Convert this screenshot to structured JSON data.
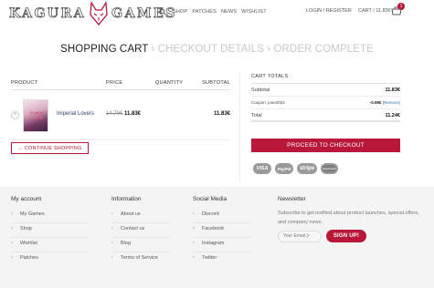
{
  "header": {
    "logo_left": "KAGURA",
    "logo_right": "GAMES",
    "nav": [
      "SHOP",
      "PATCHES",
      "NEWS",
      "WISHLIST"
    ],
    "login": "LOGIN / REGISTER",
    "cart": "CART / 11.83€",
    "cart_count": "1",
    "icons": {
      "search": "search-icon",
      "cart": "cart-icon",
      "logo": "fox-mask-icon"
    }
  },
  "steps": {
    "active": "SHOPPING CART",
    "separator": "›",
    "checkout": "CHECKOUT DETAILS",
    "complete": "ORDER COMPLETE"
  },
  "cart": {
    "columns": [
      "PRODUCT",
      "PRICE",
      "QUANTITY",
      "SUBTOTAL"
    ],
    "item": {
      "thumb_title": "Imperial Lovers",
      "name": "Imperial Lovers",
      "old_price": "14.79€",
      "price": "11.83€",
      "subtotal": "11.83€",
      "remove": "×"
    },
    "continue": "← CONTINUE SHOPPING"
  },
  "totals": {
    "title": "CART TOTALS",
    "subtotal_label": "Subtotal",
    "subtotal": "11.83€",
    "coupon_label": "Coupon: june2024",
    "coupon_value": "-0.59€",
    "coupon_remove": "[Remove]",
    "total_label": "Total",
    "total": "11.24€",
    "checkout": "PROCEED TO CHECKOUT",
    "payments": [
      "VISA",
      "PayPal",
      "stripe",
      "mastercard"
    ]
  },
  "footer": {
    "account": {
      "title": "My account",
      "items": [
        "My Games",
        "Shop",
        "Wishlist",
        "Patches"
      ]
    },
    "information": {
      "title": "Information",
      "items": [
        "About us",
        "Contact us",
        "Blog",
        "Terms of Service"
      ]
    },
    "social": {
      "title": "Social Media",
      "items": [
        "Discord",
        "Facebook",
        "Instagram",
        "Twitter"
      ]
    },
    "newsletter": {
      "title": "Newsletter",
      "text": "Subscribe to get notified about product launches, special offers, and company news.",
      "placeholder": "Your Email (r",
      "button": "SIGN UP!"
    }
  },
  "colors": {
    "accent": "#b8173a",
    "link": "#2b3f7a"
  }
}
